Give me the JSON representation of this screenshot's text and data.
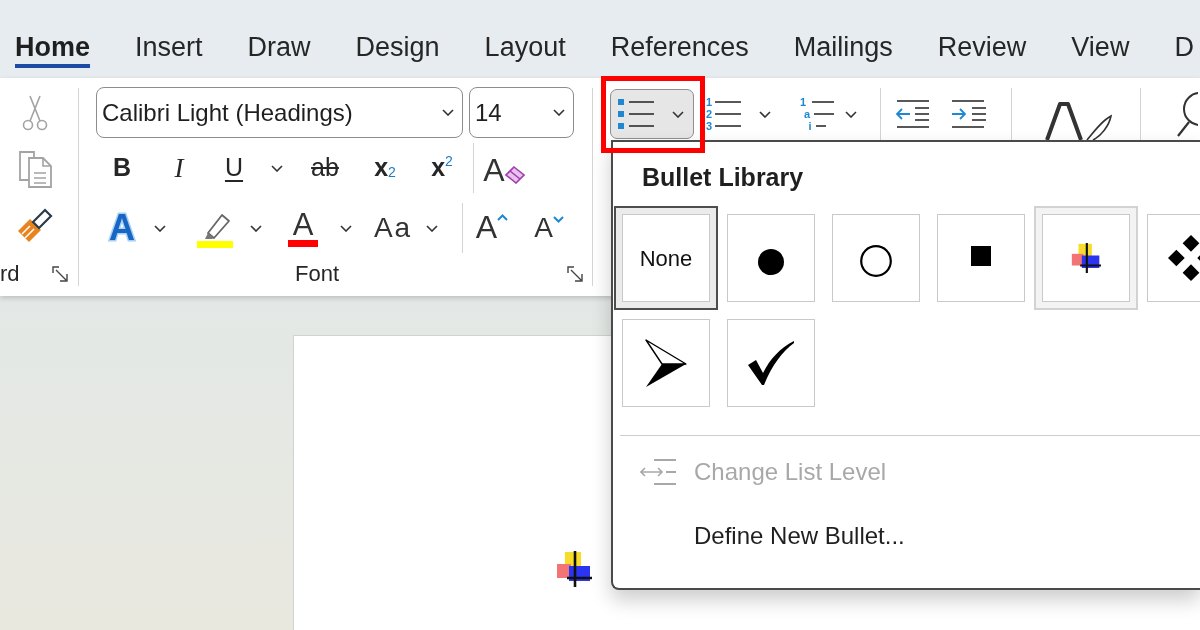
{
  "tabs": [
    {
      "label": "Home",
      "selected": true
    },
    {
      "label": "Insert",
      "selected": false
    },
    {
      "label": "Draw",
      "selected": false
    },
    {
      "label": "Design",
      "selected": false
    },
    {
      "label": "Layout",
      "selected": false
    },
    {
      "label": "References",
      "selected": false
    },
    {
      "label": "Mailings",
      "selected": false
    },
    {
      "label": "Review",
      "selected": false
    },
    {
      "label": "View",
      "selected": false
    },
    {
      "label": "D",
      "selected": false
    }
  ],
  "ribbon": {
    "clipboard": {
      "cut": {
        "disabled": true
      },
      "copy": {
        "disabled": true
      },
      "format_painter": {
        "disabled": false
      },
      "label": "rd"
    },
    "font": {
      "font_name": "Calibri Light (Headings)",
      "font_size": "14",
      "bold": "B",
      "italic": "I",
      "underline": "U",
      "strikethrough": "ab",
      "subscript": "x$_{2}$",
      "superscript": "x$^{2}$",
      "clear_formatting": "A",
      "text_effects": "A",
      "font_color": "A",
      "change_case": "Aa",
      "grow_font": "A",
      "shrink_font": "A",
      "label": "Font"
    },
    "paragraph": {
      "bullets": {
        "active": true
      },
      "numbering": {
        "markers": [
          "1",
          "2",
          "3"
        ]
      },
      "multilevel": {
        "markers": [
          "1",
          "a",
          "i"
        ]
      }
    }
  },
  "bullet_library": {
    "title": "Bullet Library",
    "items": [
      {
        "kind": "none",
        "label": "None",
        "selected": true,
        "highlighted": false
      },
      {
        "kind": "disc",
        "selected": false,
        "highlighted": false
      },
      {
        "kind": "circle",
        "selected": false,
        "highlighted": false
      },
      {
        "kind": "square",
        "selected": false,
        "highlighted": false
      },
      {
        "kind": "picture",
        "selected": false,
        "highlighted": true
      },
      {
        "kind": "diamonds",
        "selected": false,
        "highlighted": false
      },
      {
        "kind": "arrowhead",
        "selected": false,
        "highlighted": false
      },
      {
        "kind": "checkmark",
        "selected": false,
        "highlighted": false
      }
    ]
  },
  "menu_items": [
    {
      "kind": "level",
      "label": "Change List Level",
      "disabled": true
    },
    {
      "kind": "command",
      "label": "Define New Bullet...",
      "disabled": false
    }
  ]
}
